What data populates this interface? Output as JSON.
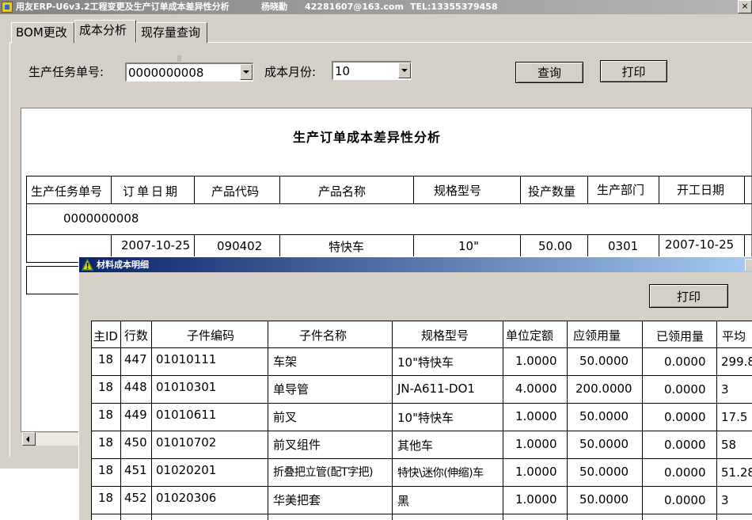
{
  "window": {
    "title_parts": [
      "用友ERP-U6v3.2工程变更及生产订单成本差异性分析",
      "杨晓勤",
      "42281607@163.com",
      "TEL:13355379458"
    ],
    "close_glyph": "×"
  },
  "tabs": [
    {
      "label": "BOM更改",
      "active": false
    },
    {
      "label": "成本分析",
      "active": true
    },
    {
      "label": "现存量查询",
      "active": false
    }
  ],
  "form": {
    "task_label": "生产任务单号:",
    "task_value": "0000000008",
    "month_label": "成本月份:",
    "month_value": "10",
    "query_button": "查询",
    "print_button": "打印"
  },
  "report": {
    "title": "生产订单成本差异性分析",
    "headers": [
      "生产任务单号",
      "订单日期",
      "产品代码",
      "产品名称",
      "规格型号",
      "投产数量",
      "生产部门",
      "开工日期"
    ],
    "group_value": "0000000008",
    "row": [
      "",
      "2007-10-25",
      "090402",
      "特快车",
      "10\"",
      "50.00",
      "0301",
      "2007-10-25"
    ]
  },
  "child": {
    "title": "材料成本明细",
    "print_button": "打印",
    "headers": [
      "主ID",
      "行数",
      "子件编码",
      "子件名称",
      "规格型号",
      "单位定额",
      "应领用量",
      "已领用量",
      "平均"
    ],
    "rows": [
      [
        "18",
        "447",
        "01010111",
        "车架",
        "10\"特快车",
        "1.0000",
        "50.0000",
        "0.0000",
        "299.8"
      ],
      [
        "18",
        "448",
        "01010301",
        "单导管",
        "JN-A611-DO1",
        "4.0000",
        "200.0000",
        "0.0000",
        "3"
      ],
      [
        "18",
        "449",
        "01010611",
        "前叉",
        "10\"特快车",
        "1.0000",
        "50.0000",
        "0.0000",
        "17.5"
      ],
      [
        "18",
        "450",
        "01010702",
        "前叉组件",
        "其他车",
        "1.0000",
        "50.0000",
        "0.0000",
        "58"
      ],
      [
        "18",
        "451",
        "01020201",
        "折叠把立管(配T字把)",
        "特快\\迷你(伸缩)车",
        "1.0000",
        "50.0000",
        "0.0000",
        "51.28"
      ],
      [
        "18",
        "452",
        "01020306",
        "华美把套",
        "黑",
        "1.0000",
        "50.0000",
        "0.0000",
        "3"
      ]
    ]
  }
}
